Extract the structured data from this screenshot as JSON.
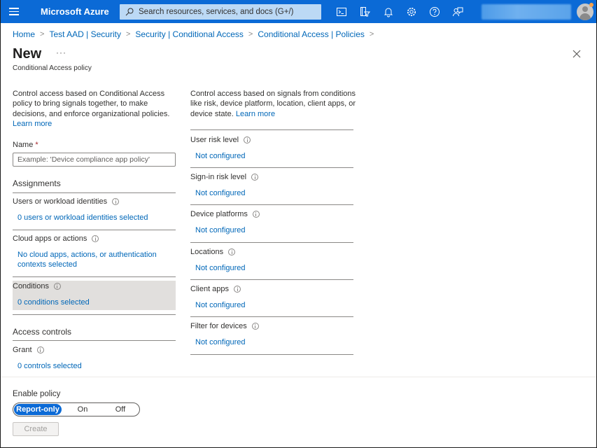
{
  "topbar": {
    "brand": "Microsoft Azure",
    "search_placeholder": "Search resources, services, and docs (G+/)",
    "icons": [
      "cloud-shell-icon",
      "directory-filter-icon",
      "notifications-icon",
      "settings-icon",
      "help-icon",
      "feedback-icon"
    ],
    "accent_color": "#0b6ad6"
  },
  "breadcrumb": [
    "Home",
    "Test AAD | Security",
    "Security | Conditional Access",
    "Conditional Access | Policies"
  ],
  "header": {
    "title": "New",
    "more": "···",
    "subtitle": "Conditional Access policy"
  },
  "left": {
    "description": "Control access based on Conditional Access policy to bring signals together, to make decisions, and enforce organizational policies.",
    "learn_more": "Learn more",
    "name_label": "Name",
    "required_mark": "*",
    "name_placeholder": "Example: 'Device compliance app policy'",
    "name_value": "",
    "assignments_heading": "Assignments",
    "assignments": [
      {
        "label": "Users or workload identities",
        "value": "0 users or workload identities selected"
      },
      {
        "label": "Cloud apps or actions",
        "value": "No cloud apps, actions, or authentication contexts selected"
      },
      {
        "label": "Conditions",
        "value": "0 conditions selected"
      }
    ],
    "access_controls_heading": "Access controls",
    "grant": {
      "label": "Grant",
      "value": "0 controls selected"
    }
  },
  "right": {
    "description": "Control access based on signals from conditions like risk, device platform, location, client apps, or device state.",
    "learn_more": "Learn more",
    "conditions": [
      {
        "label": "User risk level",
        "value": "Not configured"
      },
      {
        "label": "Sign-in risk level",
        "value": "Not configured"
      },
      {
        "label": "Device platforms",
        "value": "Not configured"
      },
      {
        "label": "Locations",
        "value": "Not configured"
      },
      {
        "label": "Client apps",
        "value": "Not configured"
      },
      {
        "label": "Filter for devices",
        "value": "Not configured"
      }
    ]
  },
  "footer": {
    "enable_policy_label": "Enable policy",
    "options": [
      "Report-only",
      "On",
      "Off"
    ],
    "selected": "Report-only",
    "create_label": "Create"
  }
}
